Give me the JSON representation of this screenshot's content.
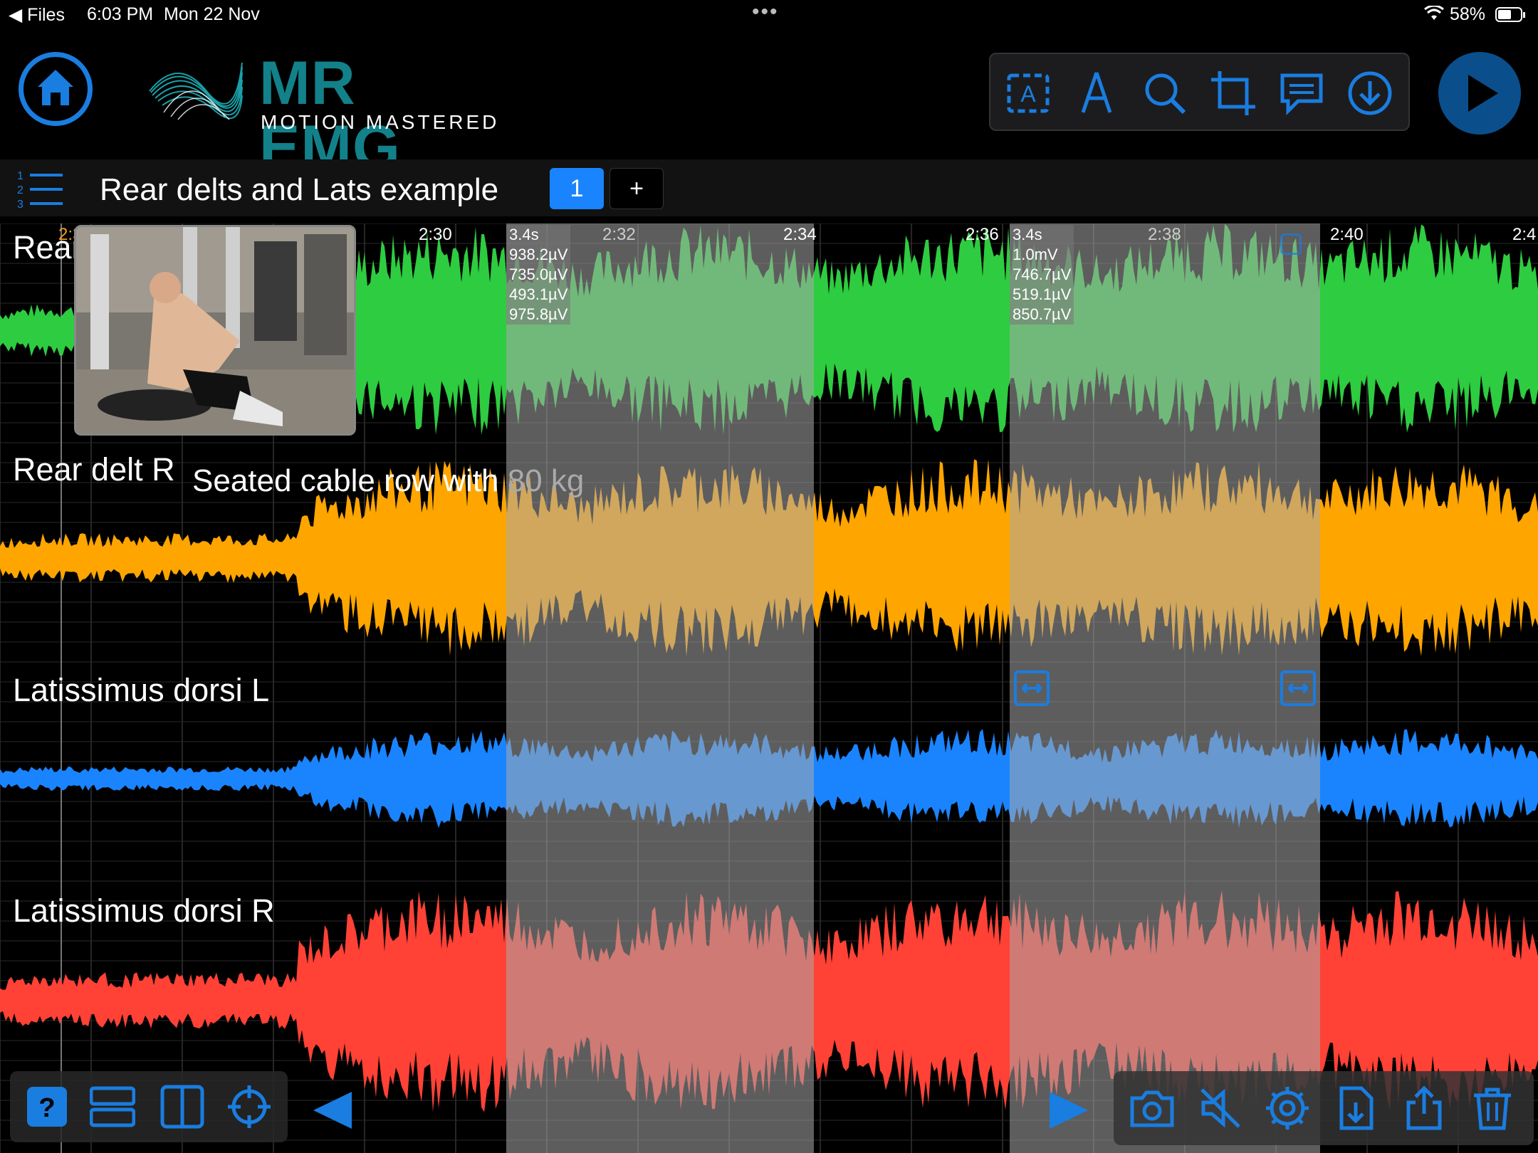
{
  "status_bar": {
    "back_label": "◀ Files",
    "time": "6:03 PM",
    "date": "Mon 22 Nov",
    "battery": "58%"
  },
  "header": {
    "brand": "MR EMG",
    "tagline": "MOTION MASTERED",
    "toolbar_icons": [
      "text-box-icon",
      "pen-icon",
      "magnifier-icon",
      "crop-icon",
      "comment-icon",
      "download-circle-icon"
    ]
  },
  "session": {
    "title": "Rear delts and Lats example",
    "tabs": [
      {
        "label": "1",
        "selected": true
      }
    ],
    "add_tab_label": "+"
  },
  "timeline": {
    "ticks": [
      "2:3",
      "2:30",
      "2:32",
      "2:34",
      "2:36",
      "2:38",
      "2:40",
      "2:4"
    ]
  },
  "channels": [
    {
      "name": "Rear delt L",
      "color": "#2ecc40"
    },
    {
      "name": "Rear delt R",
      "color": "#ffa500"
    },
    {
      "name": "Latissimus dorsi L",
      "color": "#1a84ff"
    },
    {
      "name": "Latissimus dorsi R",
      "color": "#ff4136"
    }
  ],
  "selections": [
    {
      "duration": "3.4s",
      "values": [
        "938.2µV",
        "735.0µV",
        "493.1µV",
        "975.8µV"
      ]
    },
    {
      "duration": "3.4s",
      "values": [
        "1.0mV",
        "746.7µV",
        "519.1µV",
        "850.7µV"
      ]
    }
  ],
  "annotation": {
    "text": "Seated cable row with ",
    "text_faded": "80 kg"
  },
  "bottom_left_icons": [
    "help-icon",
    "stacked-view-icon",
    "split-view-icon",
    "crosshair-icon",
    "play-reverse-icon"
  ],
  "bottom_right_icons": [
    "play-forward-icon",
    "camera-icon",
    "mute-icon",
    "settings-icon",
    "file-import-icon",
    "share-icon",
    "trash-icon"
  ],
  "colors": {
    "accent": "#1a84ff",
    "brand": "#12818a"
  }
}
